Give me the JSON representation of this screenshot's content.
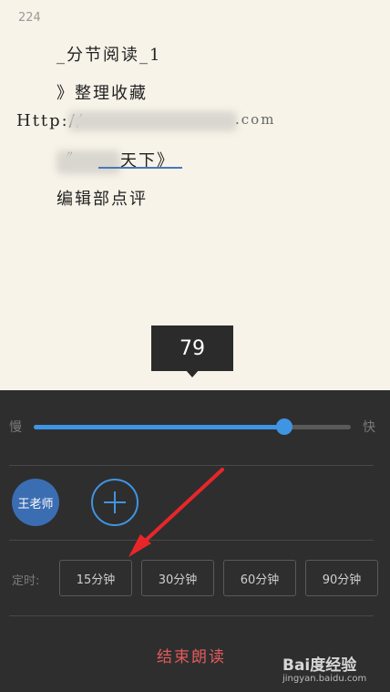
{
  "reader": {
    "status_number": "224",
    "lines": {
      "section": "_分节阅读_1",
      "collect": "》整理收藏",
      "url": "Http://",
      "url_tail": ".com",
      "book_title_start": "《",
      "book_title_end": "天下》",
      "editor_review": "编辑部点评"
    }
  },
  "speed": {
    "tooltip_value": "79",
    "slow_label": "慢",
    "fast_label": "快",
    "level_percent": 79
  },
  "voice": {
    "selected_label": "王老师"
  },
  "timer": {
    "label": "定时:",
    "options": [
      "15分钟",
      "30分钟",
      "60分钟",
      "90分钟"
    ]
  },
  "end_label": "结束朗读",
  "watermark": {
    "main": "Bai度经验",
    "sub": "jingyan.baidu.com"
  },
  "colors": {
    "accent": "#3f94e4",
    "danger": "#e25b5b",
    "panel_bg": "#2e2e2e",
    "page_bg": "#f7f3e8"
  }
}
